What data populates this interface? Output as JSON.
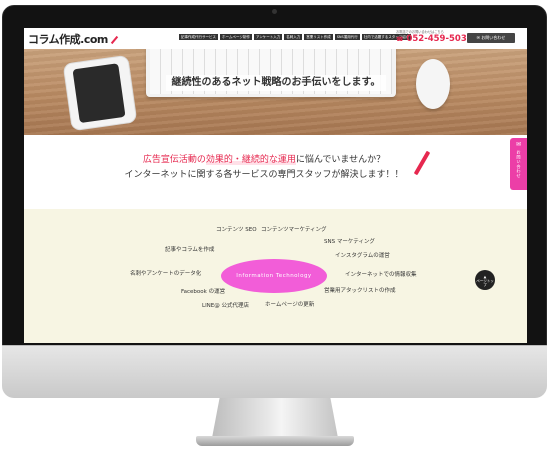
{
  "header": {
    "logo": "コラム作成.com",
    "nav_items": [
      "記事作成代行サービス",
      "ホームページ制作",
      "アンケート入力",
      "名刺入力",
      "営業リスト作成",
      "SNS運用代行",
      "社内で活躍するスタッフ紹介"
    ],
    "contact_note": "お電話でのお問い合わせはこちら",
    "phone": "052-459-5030",
    "inquiry_button": "お問い合わせ"
  },
  "hero": {
    "title": "継続性のあるネット戦略のお手伝いをします。"
  },
  "problem": {
    "line1_prefix": "広告宣伝活動の",
    "line1_highlight": "効果的・継続的な運用",
    "line1_suffix": "に悩んでいませんか？",
    "line2": "インターネットに関する各サービスの専門スタッフが解決します！！"
  },
  "side_tab": {
    "label": "お問い合わせ"
  },
  "diagram": {
    "center": "Information Technology",
    "terms": [
      "コンテンツ SEO",
      "コンテンツマーケティング",
      "SNS マーケティング",
      "インスタグラムの運営",
      "インターネットでの情報収集",
      "営業用アタックリストの作成",
      "ホームページの更新",
      "LINE@ 公式代理店",
      "Facebook の運営",
      "名刺やアンケートのデータ化",
      "記事やコラムを作成"
    ]
  },
  "page_top": {
    "label": "ページトップ"
  },
  "colors": {
    "accent": "#e6284f",
    "bubble": "#f25dd8",
    "side_tab": "#ec3ea7",
    "diagram_bg": "#f7f5e3"
  }
}
